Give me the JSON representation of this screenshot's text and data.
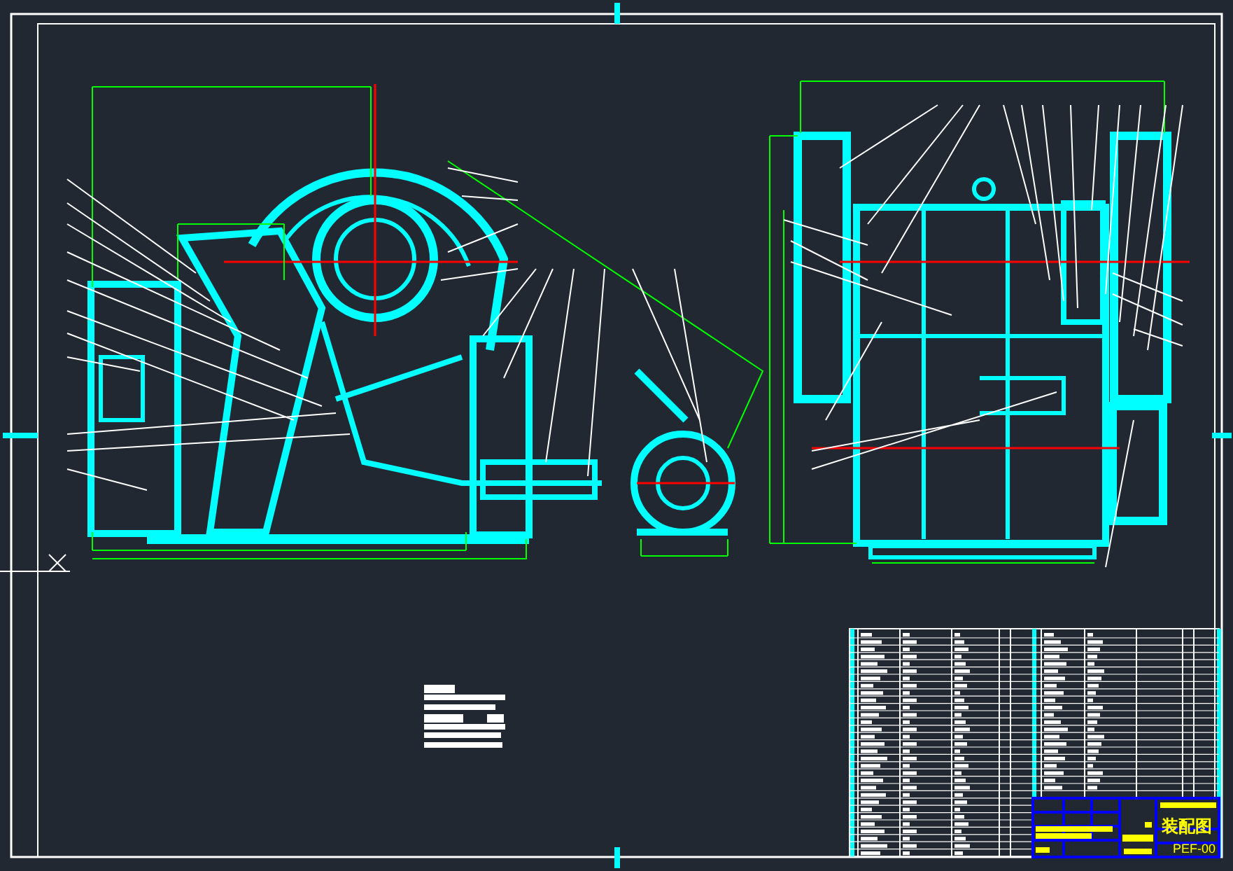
{
  "title_block": {
    "drawing_title": "装配图",
    "drawing_number": "PEF-00"
  }
}
